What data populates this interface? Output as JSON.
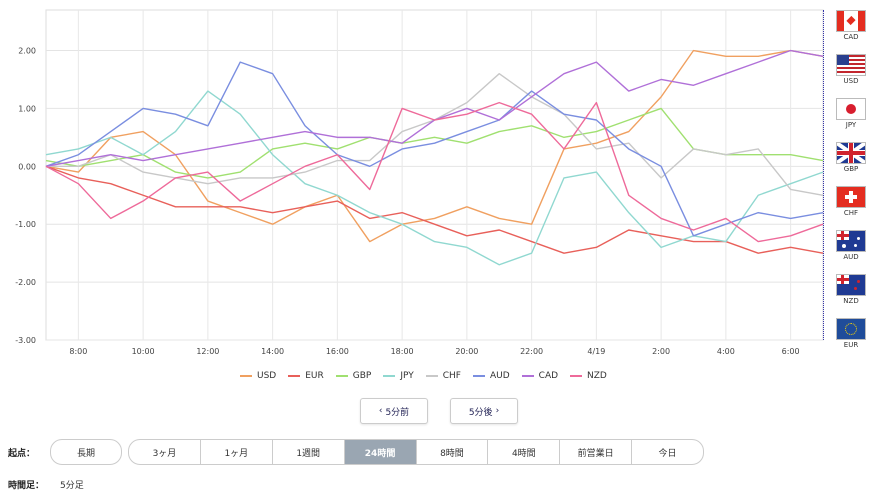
{
  "chart_data": {
    "type": "line",
    "title": "",
    "xlabel": "",
    "ylabel": "",
    "ylim": [
      -3.0,
      2.7
    ],
    "yticks": [
      "2.00",
      "1.00",
      "0.00",
      "-1.00",
      "-2.00",
      "-3.00"
    ],
    "ytick_values": [
      2,
      1,
      0,
      -1,
      -2,
      -3
    ],
    "xticks": [
      "8:00",
      "10:00",
      "12:00",
      "14:00",
      "16:00",
      "18:00",
      "20:00",
      "22:00",
      "4/19",
      "2:00",
      "4:00",
      "6:00"
    ],
    "x_hours": [
      0,
      1,
      2,
      3,
      4,
      5,
      6,
      7,
      8,
      9,
      10,
      11,
      12,
      13,
      14,
      15,
      16,
      17,
      18,
      19,
      20,
      21,
      22,
      23,
      24
    ],
    "grid": true,
    "legend_position": "bottom",
    "series": [
      {
        "name": "USD",
        "color": "#f0a060",
        "values": [
          0.0,
          -0.1,
          0.5,
          0.6,
          0.2,
          -0.6,
          -0.8,
          -1.0,
          -0.7,
          -0.5,
          -1.3,
          -1.0,
          -0.9,
          -0.7,
          -0.9,
          -1.0,
          0.3,
          0.4,
          0.6,
          1.2,
          2.0,
          1.9,
          1.9,
          2.0,
          1.9
        ]
      },
      {
        "name": "EUR",
        "color": "#e8605a",
        "values": [
          0.0,
          -0.2,
          -0.3,
          -0.5,
          -0.7,
          -0.7,
          -0.7,
          -0.8,
          -0.7,
          -0.6,
          -0.9,
          -0.8,
          -1.0,
          -1.2,
          -1.1,
          -1.3,
          -1.5,
          -1.4,
          -1.1,
          -1.2,
          -1.3,
          -1.3,
          -1.5,
          -1.4,
          -1.5
        ]
      },
      {
        "name": "GBP",
        "color": "#a0e070",
        "values": [
          0.1,
          0.0,
          0.1,
          0.2,
          -0.1,
          -0.2,
          -0.1,
          0.3,
          0.4,
          0.3,
          0.5,
          0.4,
          0.5,
          0.4,
          0.6,
          0.7,
          0.5,
          0.6,
          0.8,
          1.0,
          0.3,
          0.2,
          0.2,
          0.2,
          0.1
        ]
      },
      {
        "name": "JPY",
        "color": "#90d8d0",
        "values": [
          0.2,
          0.3,
          0.5,
          0.2,
          0.6,
          1.3,
          0.9,
          0.2,
          -0.3,
          -0.5,
          -0.8,
          -1.0,
          -1.3,
          -1.4,
          -1.7,
          -1.5,
          -0.2,
          -0.1,
          -0.8,
          -1.4,
          -1.2,
          -1.3,
          -0.5,
          -0.3,
          -0.1
        ]
      },
      {
        "name": "CHF",
        "color": "#c8c8c8",
        "values": [
          0.0,
          0.0,
          0.2,
          -0.1,
          -0.2,
          -0.3,
          -0.2,
          -0.2,
          -0.1,
          0.1,
          0.1,
          0.6,
          0.8,
          1.1,
          1.6,
          1.2,
          0.9,
          0.3,
          0.4,
          -0.2,
          0.3,
          0.2,
          0.3,
          -0.4,
          -0.5
        ]
      },
      {
        "name": "AUD",
        "color": "#7a8ee0",
        "values": [
          0.0,
          0.2,
          0.6,
          1.0,
          0.9,
          0.7,
          1.8,
          1.6,
          0.7,
          0.2,
          0.0,
          0.3,
          0.4,
          0.6,
          0.8,
          1.3,
          0.9,
          0.8,
          0.3,
          0.0,
          -1.2,
          -1.0,
          -0.8,
          -0.9,
          -0.8
        ]
      },
      {
        "name": "CAD",
        "color": "#b070d8",
        "values": [
          0.0,
          0.1,
          0.2,
          0.1,
          0.2,
          0.3,
          0.4,
          0.5,
          0.6,
          0.5,
          0.5,
          0.4,
          0.8,
          1.0,
          0.8,
          1.2,
          1.6,
          1.8,
          1.3,
          1.5,
          1.4,
          1.6,
          1.8,
          2.0,
          1.9
        ]
      },
      {
        "name": "NZD",
        "color": "#ee6a9a",
        "values": [
          0.0,
          -0.3,
          -0.9,
          -0.6,
          -0.2,
          -0.1,
          -0.6,
          -0.3,
          0.0,
          0.2,
          -0.4,
          1.0,
          0.8,
          0.9,
          1.1,
          0.9,
          0.3,
          1.1,
          -0.5,
          -0.9,
          -1.1,
          -0.9,
          -1.3,
          -1.2,
          -1.0
        ]
      }
    ]
  },
  "flags": [
    "CAD",
    "USD",
    "JPY",
    "GBP",
    "CHF",
    "AUD",
    "NZD",
    "EUR"
  ],
  "nav": {
    "prev_label": "5分前",
    "prev_icon": "‹",
    "next_label": "5分後",
    "next_icon": "›"
  },
  "period": {
    "label": "起点：",
    "long_label": "長期",
    "options": [
      "3ヶ月",
      "1ヶ月",
      "1週間",
      "24時間",
      "8時間",
      "4時間",
      "前営業日",
      "今日"
    ],
    "active": "24時間"
  },
  "interval": {
    "label": "時間足：",
    "value": "5分足"
  }
}
